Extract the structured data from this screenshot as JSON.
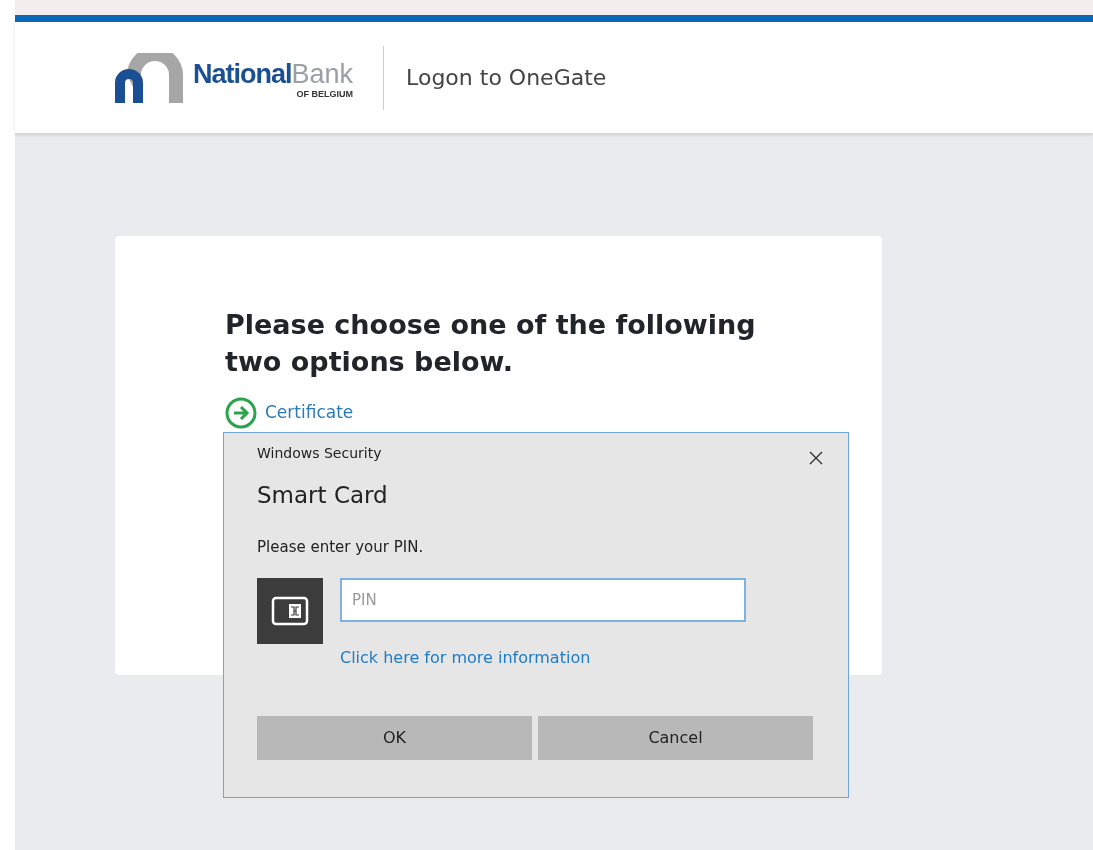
{
  "header": {
    "logo": {
      "name_bold": "National",
      "name_light": "Bank",
      "tagline": "OF BELGIUM"
    },
    "title": "Logon to OneGate"
  },
  "card": {
    "heading": "Please choose one of the following two options below.",
    "options": [
      {
        "label": "Certificate"
      }
    ]
  },
  "dialog": {
    "window_title": "Windows Security",
    "title": "Smart Card",
    "prompt": "Please enter your PIN.",
    "pin": {
      "placeholder": "PIN"
    },
    "info_link": "Click here for more information",
    "buttons": [
      "OK",
      "Cancel"
    ]
  }
}
